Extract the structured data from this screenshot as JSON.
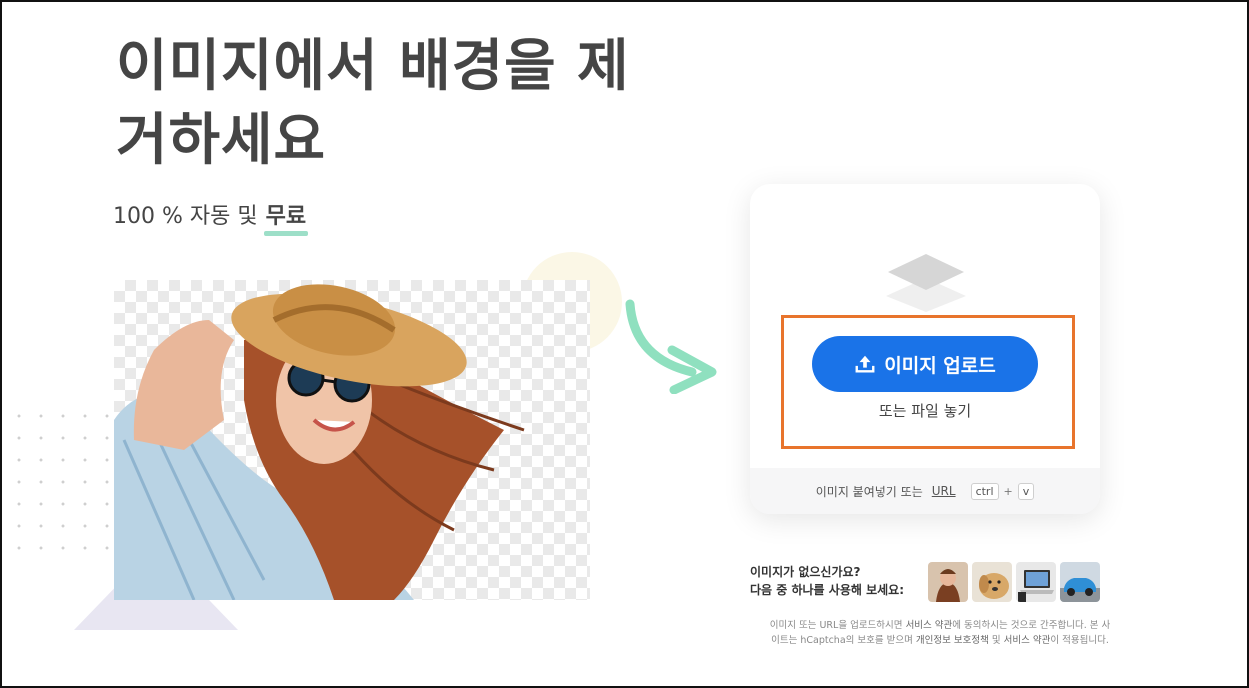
{
  "hero": {
    "title_line1": "이미지에서 배경을 제",
    "title_line2": "거하세요",
    "subtitle_prefix": "100 % 자동 및",
    "subtitle_emphasis": "무료"
  },
  "upload": {
    "button_label": "이미지 업로드",
    "drop_text": "또는 파일 놓기",
    "paste_prefix": "이미지 붙여넣기 또는",
    "paste_url": "URL",
    "key_ctrl": "ctrl",
    "key_plus": "+",
    "key_v": "v"
  },
  "samples": {
    "line1": "이미지가 없으신가요?",
    "line2": "다음 중 하나를 사용해 보세요:",
    "items": [
      "woman-portrait",
      "dog",
      "laptop",
      "car"
    ]
  },
  "legal": {
    "line1_a": "이미지 또는 URL을 업로드하시면",
    "line1_b": "서비스 약관",
    "line1_c": "에 동의하시는 것으로 간주합니다. 본 사",
    "line2_a": "이트는 hCaptcha의 보호를 받으며",
    "line2_b": "개인정보 보호정책",
    "line2_c": "및",
    "line2_d": "서비스 약관",
    "line2_e": "이 적용됩니다."
  },
  "colors": {
    "primary": "#1a73e8",
    "accent_underline": "#9ddfc8",
    "arrow": "#8fe0bf",
    "highlight_box": "#e8742c"
  }
}
